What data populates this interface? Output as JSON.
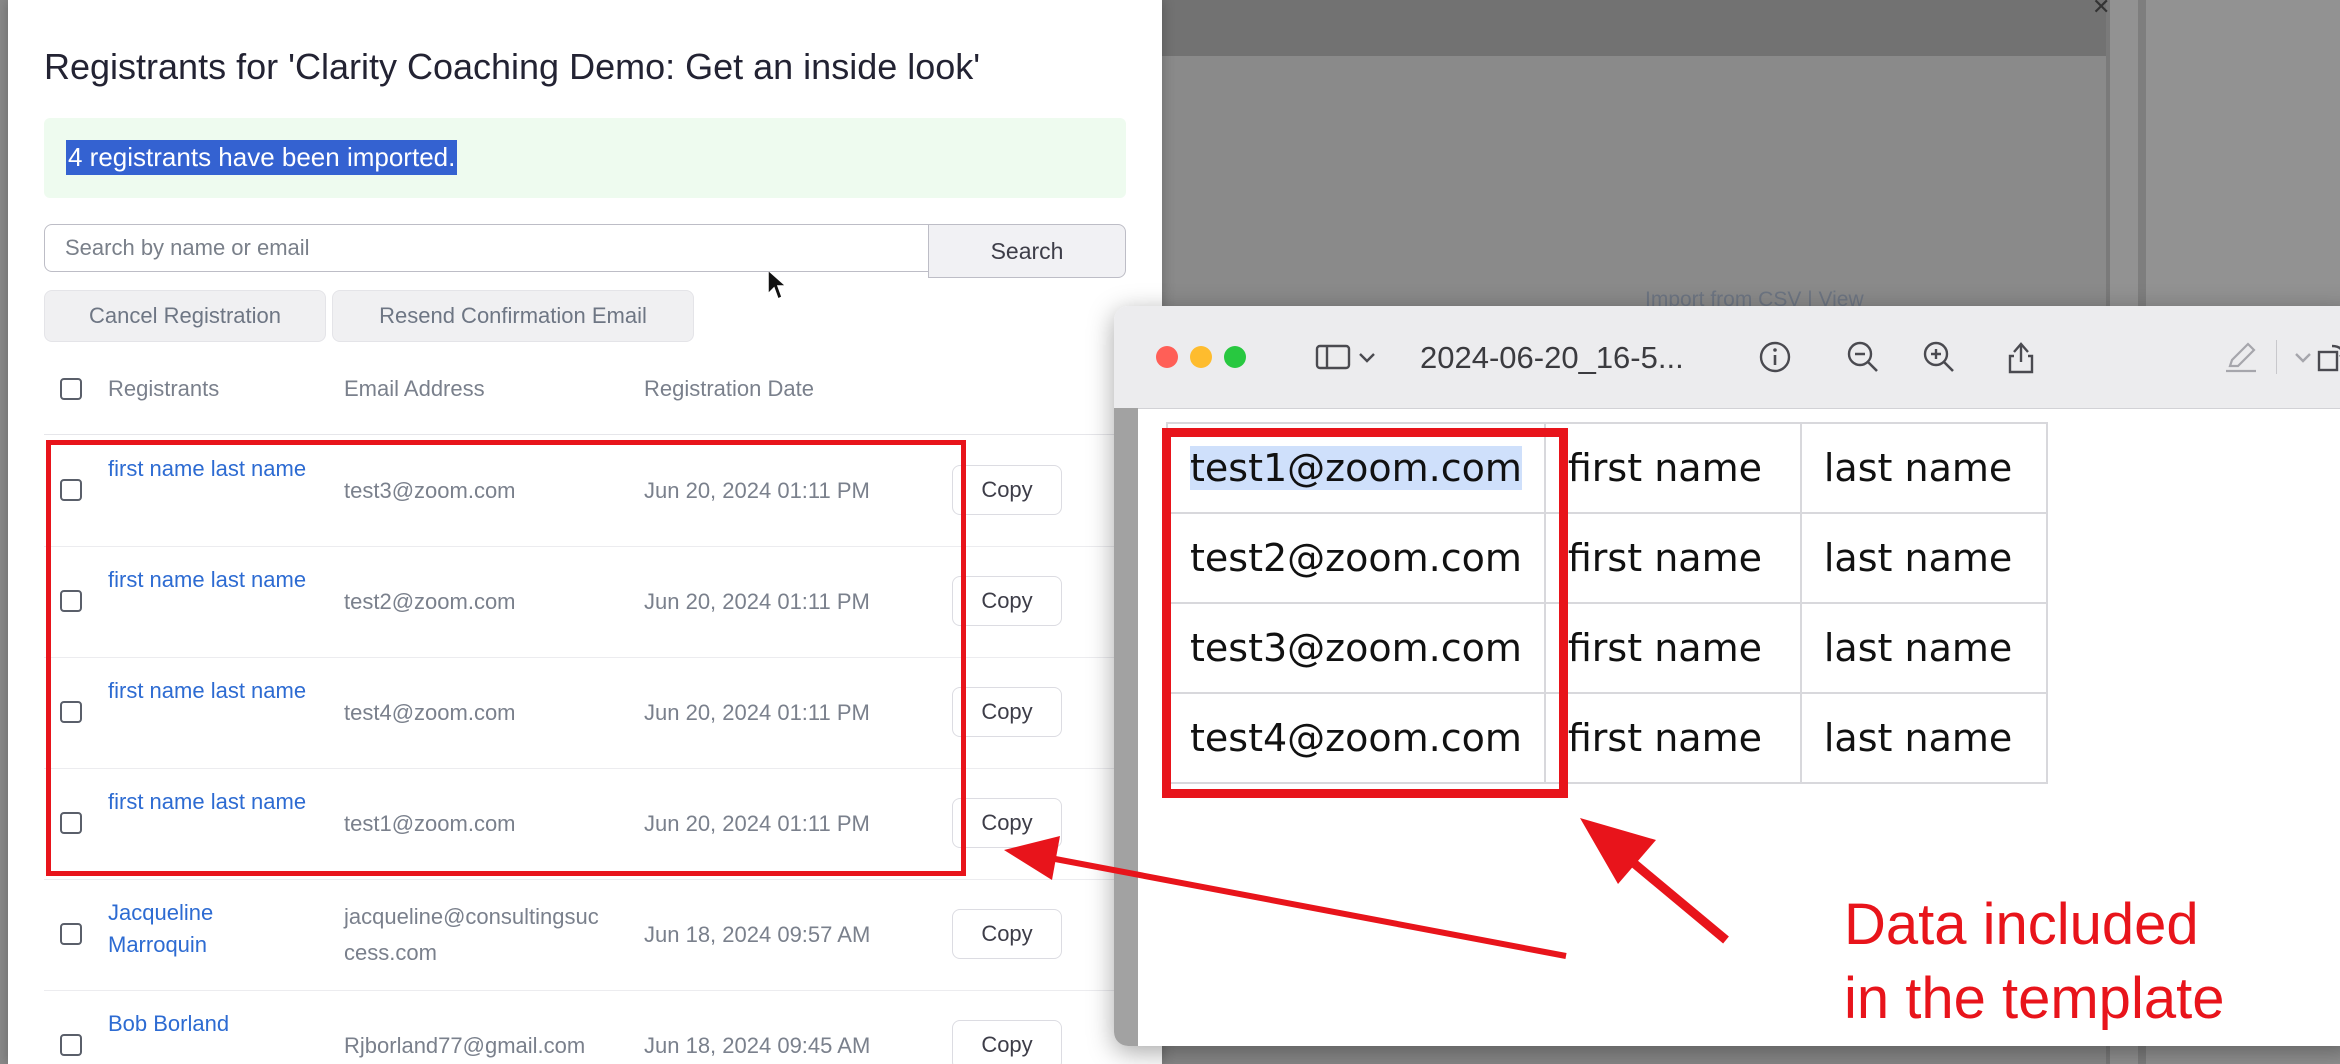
{
  "background": {
    "link_text": "Import from CSV | View"
  },
  "dialog": {
    "title": "Registrants for 'Clarity Coaching Demo: Get an inside look'",
    "banner": "4 registrants have been imported.",
    "search": {
      "placeholder": "Search by name or email",
      "button_label": "Search"
    },
    "actions": {
      "cancel_label": "Cancel Registration",
      "resend_label": "Resend Confirmation Email"
    },
    "columns": [
      "Registrants",
      "Email Address",
      "Registration Date"
    ],
    "rows": [
      {
        "name": "first name last name",
        "email": "test3@zoom.com",
        "date": "Jun 20, 2024 01:11 PM",
        "copy": "Copy"
      },
      {
        "name": "first name last name",
        "email": "test2@zoom.com",
        "date": "Jun 20, 2024 01:11 PM",
        "copy": "Copy"
      },
      {
        "name": "first name last name",
        "email": "test4@zoom.com",
        "date": "Jun 20, 2024 01:11 PM",
        "copy": "Copy"
      },
      {
        "name": "first name last name",
        "email": "test1@zoom.com",
        "date": "Jun 20, 2024 01:11 PM",
        "copy": "Copy"
      },
      {
        "name": "Jacqueline Marroquin",
        "email": "jacqueline@consultingsuccess.com",
        "date": "Jun 18, 2024 09:57 AM",
        "copy": "Copy"
      },
      {
        "name": "Bob Borland",
        "email": "Rjborland77@gmail.com",
        "date": "Jun 18, 2024 09:45 AM",
        "copy": "Copy"
      }
    ]
  },
  "preview": {
    "filename": "2024-06-20_16-5...",
    "table": [
      [
        "test1@zoom.com",
        "first name",
        "last name"
      ],
      [
        "test2@zoom.com",
        "first name",
        "last name"
      ],
      [
        "test3@zoom.com",
        "first name",
        "last name"
      ],
      [
        "test4@zoom.com",
        "first name",
        "last name"
      ]
    ]
  },
  "annotation": {
    "line1": "Data included",
    "line2": "in the template",
    "color": "#e8141b"
  },
  "colors": {
    "link_blue": "#2d6bd2",
    "banner_bg": "#eefbef",
    "selection": "#3462d1"
  },
  "icons": [
    "sidebar-icon",
    "chevron-down-icon",
    "info-icon",
    "zoom-out-icon",
    "zoom-in-icon",
    "share-icon",
    "markup-pen-icon",
    "rotate-icon",
    "cursor-arrow-icon"
  ]
}
